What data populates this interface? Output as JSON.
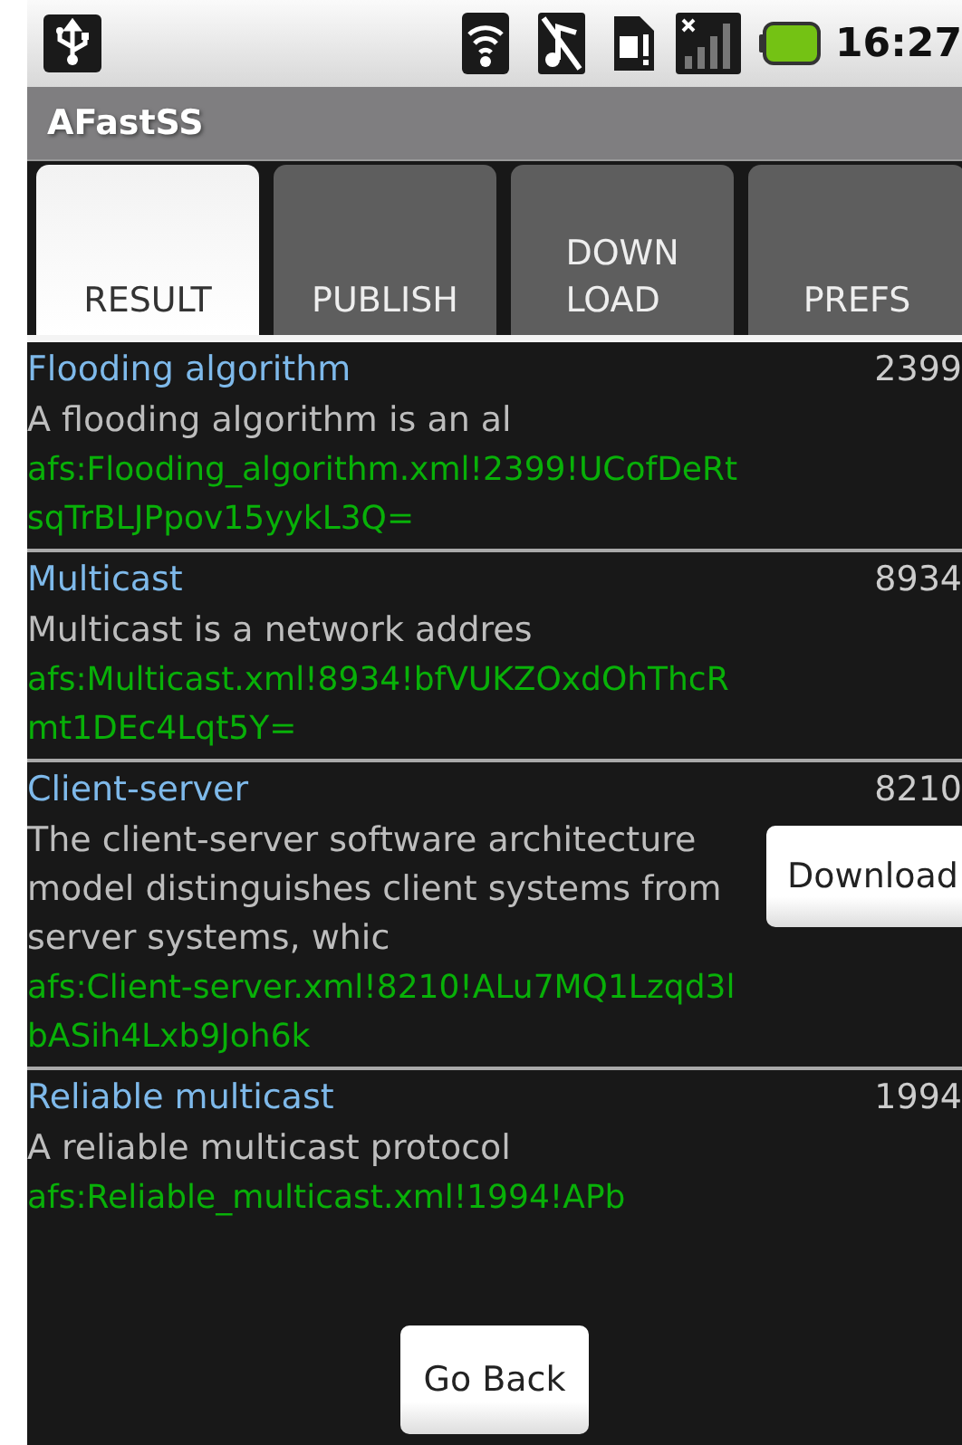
{
  "status_bar": {
    "time": "16:27"
  },
  "app": {
    "title": "AFastSS"
  },
  "tabs": [
    {
      "label": "RESULT",
      "selected": true
    },
    {
      "label": "PUBLISH",
      "selected": false
    },
    {
      "label": "DOWN\nLOAD",
      "selected": false
    },
    {
      "label": "PREFS",
      "selected": false
    }
  ],
  "results": [
    {
      "title": "Flooding algorithm",
      "count": "2399",
      "summary": "A flooding algorithm is an al",
      "link": "afs:Flooding_algorithm.xml!2399!UCofDeRtsqTrBLJPpov15yykL3Q="
    },
    {
      "title": "Multicast",
      "count": "8934",
      "summary": "Multicast is a network addres",
      "link": "afs:Multicast.xml!8934!bfVUKZOxdOhThcRmt1DEc4Lqt5Y="
    },
    {
      "title": "Client-server",
      "count": "8210",
      "summary": "The client-server software architecture model distinguishes client systems from server systems, whic",
      "link": "afs:Client-server.xml!8210!ALu7MQ1Lzqd3lbASih4Lxb9Joh6k",
      "action": "Download"
    },
    {
      "title": "Reliable multicast",
      "count": "1994",
      "summary": "A reliable multicast protocol",
      "link": "afs:Reliable_multicast.xml!1994!APb"
    }
  ],
  "footer_button": "Go Back"
}
